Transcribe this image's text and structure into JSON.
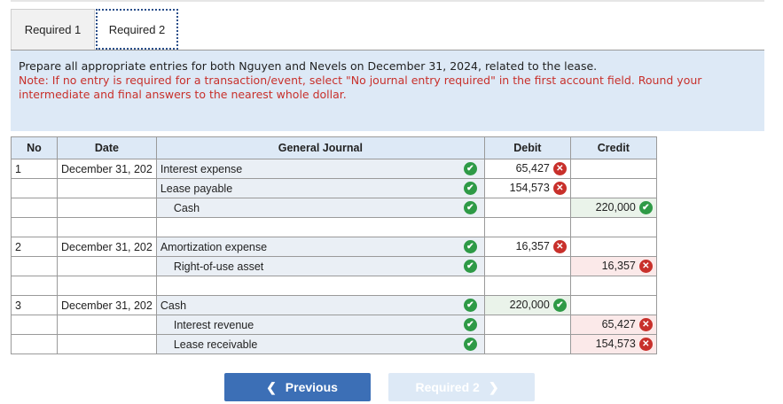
{
  "tabs": [
    {
      "label": "Required 1"
    },
    {
      "label": "Required 2"
    }
  ],
  "instructions": {
    "main": "Prepare all appropriate entries for both Nguyen and Nevels on December 31, 2024, related to the lease.",
    "note": "Note: If no entry is required for a transaction/event, select \"No journal entry required\" in the first account field. Round your intermediate and final answers to the nearest whole dollar."
  },
  "table": {
    "headers": {
      "no": "No",
      "date": "Date",
      "journal": "General Journal",
      "debit": "Debit",
      "credit": "Credit"
    },
    "rows": [
      {
        "no": "1",
        "date": "December 31, 202",
        "account": "Interest expense",
        "debit": "65,427",
        "credit": ""
      },
      {
        "no": "",
        "date": "",
        "account": "Lease payable",
        "debit": "154,573",
        "credit": ""
      },
      {
        "no": "",
        "date": "",
        "account": "Cash",
        "debit": "",
        "credit": "220,000"
      },
      {
        "no": "",
        "date": "",
        "account": "",
        "debit": "",
        "credit": ""
      },
      {
        "no": "2",
        "date": "December 31, 202",
        "account": "Amortization expense",
        "debit": "16,357",
        "credit": ""
      },
      {
        "no": "",
        "date": "",
        "account": "Right-of-use asset",
        "debit": "",
        "credit": "16,357"
      },
      {
        "no": "",
        "date": "",
        "account": "",
        "debit": "",
        "credit": ""
      },
      {
        "no": "3",
        "date": "December 31, 202",
        "account": "Cash",
        "debit": "220,000",
        "credit": ""
      },
      {
        "no": "",
        "date": "",
        "account": "Interest revenue",
        "debit": "",
        "credit": "65,427"
      },
      {
        "no": "",
        "date": "",
        "account": "Lease receivable",
        "debit": "",
        "credit": "154,573"
      }
    ]
  },
  "buttons": {
    "previous": "Previous",
    "next": "Required 2"
  },
  "colors": {
    "correct": "#2e9a46",
    "incorrect": "#c8302b",
    "header_bg": "#dde9f6",
    "primary_button": "#3c6fb6"
  }
}
